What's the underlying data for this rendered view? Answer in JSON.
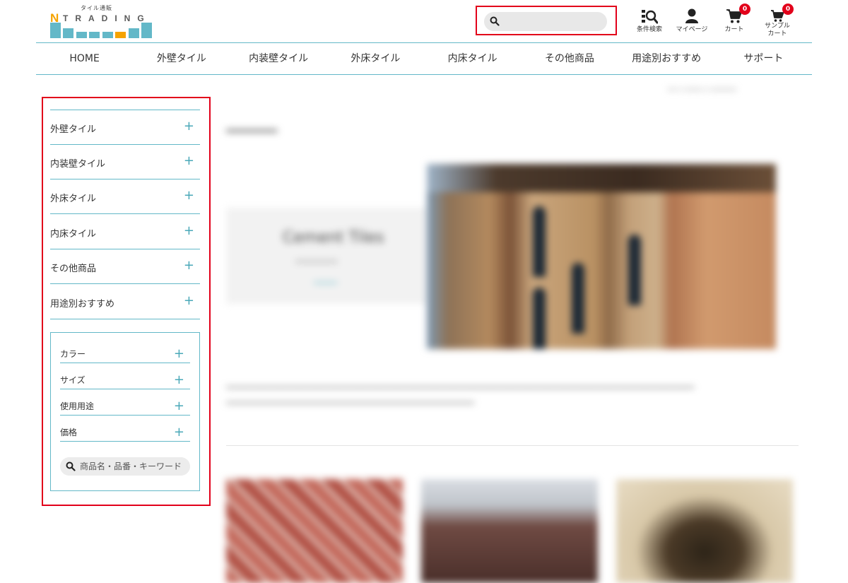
{
  "logo": {
    "tagline": "タイル通販",
    "initial": "N",
    "word": "TRADING"
  },
  "header": {
    "search_placeholder": "",
    "icons": [
      {
        "name": "condition-search",
        "label": "条件検索",
        "icon": "magnifier-grid-icon"
      },
      {
        "name": "my-page",
        "label": "マイページ",
        "icon": "user-icon"
      },
      {
        "name": "cart",
        "label": "カート",
        "icon": "cart-icon",
        "badge": "0"
      },
      {
        "name": "sample-cart",
        "label_line1": "サンプル",
        "label_line2": "カート",
        "icon": "cart-icon",
        "badge": "0"
      }
    ]
  },
  "nav": {
    "items": [
      "HOME",
      "外壁タイル",
      "内装壁タイル",
      "外床タイル",
      "内床タイル",
      "その他商品",
      "用途別おすすめ",
      "サポート"
    ]
  },
  "sidebar": {
    "categories": [
      "外壁タイル",
      "内装壁タイル",
      "外床タイル",
      "内床タイル",
      "その他商品",
      "用途別おすすめ"
    ],
    "filters": [
      "カラー",
      "サイズ",
      "使用用途",
      "価格"
    ],
    "keyword_placeholder": "商品名・品番・キーワード",
    "expand_symbol": "+"
  },
  "main": {
    "hero_heading": "Cement Tiles"
  },
  "colors": {
    "accent": "#63b8c8",
    "highlight": "#e2001a",
    "logo_orange": "#f5a300",
    "badge": "#e2001a"
  }
}
